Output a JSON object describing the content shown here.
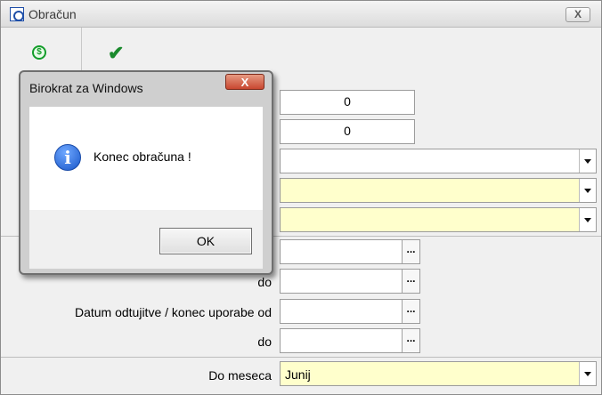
{
  "window": {
    "title": "Obračun",
    "close_label": "X"
  },
  "toolbar": {
    "dollar_icon": "$",
    "check_icon": "✔"
  },
  "form": {
    "num1": "0",
    "num2": "0",
    "label_do": "do",
    "label_date_alienation": "Datum odtujitve / konec uporabe od",
    "label_do2": "do",
    "label_month": "Do meseca",
    "month_value": "Junij",
    "dots": "..."
  },
  "dialog": {
    "title": "Birokrat za Windows",
    "close_label": "X",
    "message": "Konec obračuna !",
    "ok_label": "OK",
    "info_icon_char": "i"
  }
}
